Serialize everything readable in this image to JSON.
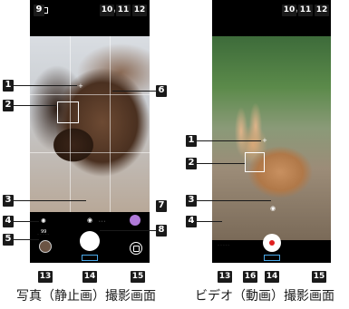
{
  "photo": {
    "caption": "写真（静止画）撮影画面",
    "badges": [
      "1",
      "2",
      "3",
      "4",
      "5",
      "6",
      "7",
      "8",
      "9",
      "10",
      "11",
      "12",
      "13",
      "14",
      "15"
    ]
  },
  "video": {
    "caption": "ビデオ（動画）撮影画面",
    "badges": [
      "1",
      "2",
      "3",
      "4",
      "10",
      "11",
      "12",
      "13",
      "14",
      "15",
      "16"
    ]
  },
  "colors": {
    "badge_bg": "#1a1a1a",
    "accent_blue": "#4aa8e8",
    "record_red": "#e02020",
    "purple": "#b07ad8"
  }
}
